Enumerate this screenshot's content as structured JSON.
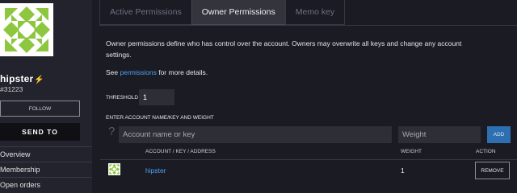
{
  "sidebar": {
    "account_name": "hipster",
    "account_number": "#31223",
    "follow_label": "FOLLOW",
    "send_label": "SEND TO",
    "menu": [
      {
        "label": "Overview"
      },
      {
        "label": "Membership"
      },
      {
        "label": "Open orders"
      }
    ]
  },
  "tabs": [
    {
      "label": "Active Permissions",
      "active": false
    },
    {
      "label": "Owner Permissions",
      "active": true
    },
    {
      "label": "Memo key",
      "active": false
    }
  ],
  "main": {
    "description": "Owner permissions define who has control over the account. Owners may overwrite all keys and change any account settings.",
    "see_prefix": "See ",
    "see_link": "permissions",
    "see_suffix": " for more details.",
    "threshold_label": "THRESHOLD",
    "threshold_value": "1",
    "enter_label": "ENTER ACCOUNT NAME/KEY AND WEIGHT",
    "name_placeholder": "Account name or key",
    "weight_placeholder": "Weight",
    "add_label": "ADD"
  },
  "table": {
    "columns": {
      "account": "ACCOUNT / KEY / ADDRESS",
      "weight": "WEIGHT",
      "action": "ACTION"
    },
    "rows": [
      {
        "account": "hipster",
        "weight": "1",
        "action": "REMOVE"
      }
    ]
  },
  "colors": {
    "identicon": "#8dc63f",
    "link": "#4aa3f0",
    "accent": "#2d6fb0"
  }
}
